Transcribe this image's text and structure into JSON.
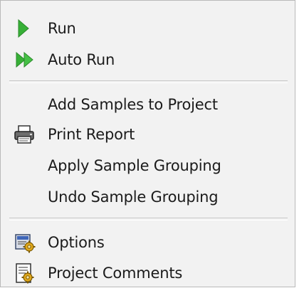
{
  "menu": {
    "items": [
      {
        "label": "Run",
        "icon": "play-icon",
        "accent": "#3cb43c"
      },
      {
        "label": "Auto Run",
        "icon": "double-play-icon",
        "accent": "#3cb43c"
      },
      {
        "label": "Add Samples to Project"
      },
      {
        "label": "Print Report",
        "icon": "printer-icon"
      },
      {
        "label": "Apply Sample Grouping"
      },
      {
        "label": "Undo Sample Grouping"
      },
      {
        "label": "Options",
        "icon": "options-icon"
      },
      {
        "label": "Project Comments",
        "icon": "project-comments-icon"
      }
    ]
  }
}
